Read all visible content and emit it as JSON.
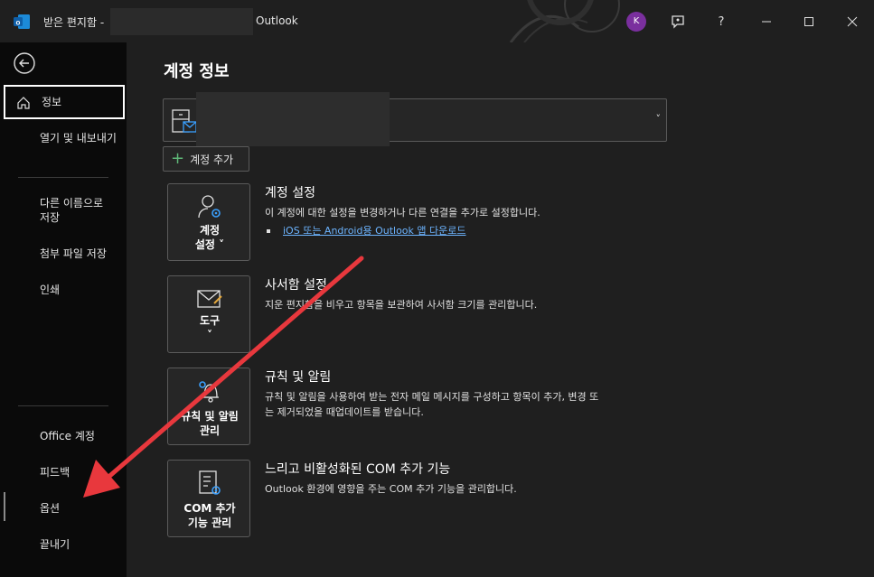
{
  "titlebar": {
    "title": "받은 편지함 -",
    "app": "Outlook",
    "avatar_initial": "K",
    "icons": [
      "outlook-logo",
      "avatar",
      "feedback-icon",
      "help-icon",
      "minimize-icon",
      "maximize-icon",
      "close-icon"
    ],
    "help_label": "?"
  },
  "nav": {
    "back_icon": "back-arrow-icon",
    "items": [
      {
        "label": "정보",
        "icon": "home-icon",
        "selected": true
      },
      {
        "label": "열기 및 내보내기"
      },
      {
        "label": "다른 이름으로 저장"
      },
      {
        "label": "첨부 파일 저장"
      },
      {
        "label": "인쇄"
      },
      {
        "label": "Office 계정"
      },
      {
        "label": "피드백"
      },
      {
        "label": "옵션"
      },
      {
        "label": "끝내기"
      }
    ]
  },
  "main": {
    "page_title": "계정 정보",
    "add_account_label": "계정 추가",
    "sections": [
      {
        "tile_label_1": "계정",
        "tile_label_2": "설정 ˅",
        "icon": "account-settings-icon",
        "title": "계정 설정",
        "desc": "이 계정에 대한 설정을 변경하거나 다른 연결을 추가로 설정합니다.",
        "link": "iOS 또는 Android용 Outlook 앱 다운로드"
      },
      {
        "tile_label_1": "도구",
        "tile_label_2": "˅",
        "icon": "mailbox-tools-icon",
        "title": "사서함 설정",
        "desc": "지운 편지함을 비우고 항목을 보관하여 사서함 크기를 관리합니다."
      },
      {
        "tile_label_1": "규칙 및 알림",
        "tile_label_2": "관리",
        "icon": "rules-alerts-icon",
        "title": "규칙 및 알림",
        "desc_1": "규칙 및 알림을 사용하여 받는 전자 메일 메시지를 구성하고 항목이 추가, 변경 또",
        "desc_2": "는 제거되었을 때업데이트를 받습니다."
      },
      {
        "tile_label_1": "COM 추가",
        "tile_label_2": "기능 관리",
        "icon": "com-addins-icon",
        "title": "느리고 비활성화된 COM 추가 기능",
        "desc": "Outlook 환경에 영향을 주는 COM 추가 기능을 관리합니다."
      }
    ]
  },
  "colors": {
    "background": "#1f1f1f",
    "nav_background": "#0a0a0a",
    "link": "#6cb4ff",
    "annotation_arrow": "#e8383d",
    "avatar": "#7a2f9e"
  }
}
